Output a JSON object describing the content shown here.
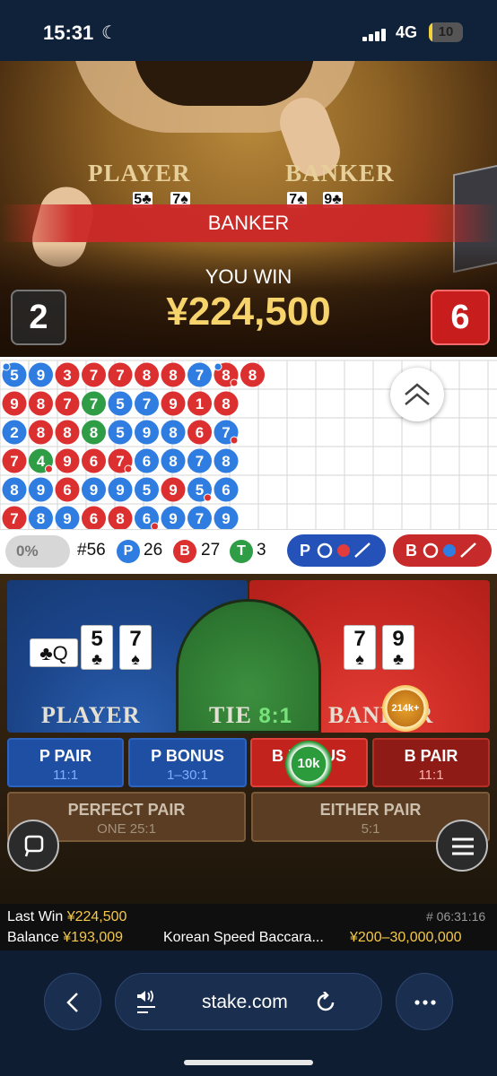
{
  "status_bar": {
    "time": "15:31",
    "network": "4G",
    "battery": "10",
    "battery_level": 0.1
  },
  "stream": {
    "table_player_label": "PLAYER",
    "table_banker_label": "BANKER",
    "player_cards": [
      {
        "rank": "5",
        "suit": "♣"
      },
      {
        "rank": "7",
        "suit": "♠"
      }
    ],
    "banker_cards": [
      {
        "rank": "7",
        "suit": "♠"
      },
      {
        "rank": "9",
        "suit": "♣"
      }
    ],
    "result_banner": "BANKER",
    "win_title": "YOU WIN",
    "win_amount": "¥224,500",
    "player_score": "2",
    "banker_score": "6"
  },
  "roadmap": {
    "colors": {
      "player": "#2f7de1",
      "banker": "#dc2f2f",
      "tie": "#2f9c46"
    },
    "columns": [
      [
        {
          "c": "P",
          "v": "5",
          "pp": true
        },
        {
          "c": "B",
          "v": "9"
        },
        {
          "c": "P",
          "v": "2"
        },
        {
          "c": "B",
          "v": "7"
        },
        {
          "c": "P",
          "v": "8"
        },
        {
          "c": "B",
          "v": "7"
        }
      ],
      [
        {
          "c": "P",
          "v": "9"
        },
        {
          "c": "B",
          "v": "8"
        },
        {
          "c": "B",
          "v": "8"
        },
        {
          "c": "T",
          "v": "4",
          "bp": true
        },
        {
          "c": "P",
          "v": "9"
        },
        {
          "c": "P",
          "v": "8"
        }
      ],
      [
        {
          "c": "B",
          "v": "3"
        },
        {
          "c": "B",
          "v": "7"
        },
        {
          "c": "B",
          "v": "8"
        },
        {
          "c": "B",
          "v": "9"
        },
        {
          "c": "B",
          "v": "6"
        },
        {
          "c": "P",
          "v": "9"
        }
      ],
      [
        {
          "c": "B",
          "v": "7"
        },
        {
          "c": "T",
          "v": "7"
        },
        {
          "c": "T",
          "v": "8"
        },
        {
          "c": "B",
          "v": "6"
        },
        {
          "c": "P",
          "v": "9"
        },
        {
          "c": "B",
          "v": "6"
        }
      ],
      [
        {
          "c": "B",
          "v": "7"
        },
        {
          "c": "P",
          "v": "5"
        },
        {
          "c": "P",
          "v": "5"
        },
        {
          "c": "B",
          "v": "7",
          "bp": true
        },
        {
          "c": "P",
          "v": "9"
        },
        {
          "c": "B",
          "v": "8"
        }
      ],
      [
        {
          "c": "B",
          "v": "8"
        },
        {
          "c": "P",
          "v": "7"
        },
        {
          "c": "P",
          "v": "9"
        },
        {
          "c": "P",
          "v": "6"
        },
        {
          "c": "P",
          "v": "5"
        },
        {
          "c": "P",
          "v": "6",
          "bp": true
        }
      ],
      [
        {
          "c": "B",
          "v": "8"
        },
        {
          "c": "B",
          "v": "9"
        },
        {
          "c": "P",
          "v": "8"
        },
        {
          "c": "P",
          "v": "8"
        },
        {
          "c": "B",
          "v": "9"
        },
        {
          "c": "P",
          "v": "9"
        }
      ],
      [
        {
          "c": "P",
          "v": "7"
        },
        {
          "c": "B",
          "v": "1"
        },
        {
          "c": "B",
          "v": "6"
        },
        {
          "c": "P",
          "v": "7"
        },
        {
          "c": "P",
          "v": "5",
          "bp": true
        },
        {
          "c": "P",
          "v": "7"
        }
      ],
      [
        {
          "c": "B",
          "v": "8",
          "pp": true,
          "bp": true
        },
        {
          "c": "B",
          "v": "8"
        },
        {
          "c": "P",
          "v": "7",
          "bp": true
        },
        {
          "c": "P",
          "v": "8"
        },
        {
          "c": "P",
          "v": "6"
        },
        {
          "c": "P",
          "v": "9"
        }
      ],
      [
        {
          "c": "B",
          "v": "8"
        }
      ]
    ]
  },
  "stats": {
    "percentage": "0%",
    "shoe_number": "#56",
    "player_letter": "P",
    "player_count": "26",
    "banker_letter": "B",
    "banker_count": "27",
    "tie_letter": "T",
    "tie_count": "3",
    "player_predict_letter": "P",
    "banker_predict_letter": "B"
  },
  "betting": {
    "player_label": "PLAYER",
    "tie_label": "TIE",
    "tie_payout": "8:1",
    "banker_label": "BANKER",
    "player_cards": [
      {
        "rank": "5",
        "suit": "♣"
      },
      {
        "rank": "7",
        "suit": "♠"
      }
    ],
    "player_side_card": "♣Q",
    "banker_cards": [
      {
        "rank": "7",
        "suit": "♠"
      },
      {
        "rank": "9",
        "suit": "♣"
      }
    ],
    "banker_chip": "214k+",
    "side_bets": [
      {
        "label": "P PAIR",
        "payout": "11:1"
      },
      {
        "label": "P BONUS",
        "payout": "1–30:1"
      },
      {
        "label": "B BONUS",
        "payout": ""
      },
      {
        "label": "B PAIR",
        "payout": "11:1"
      }
    ],
    "bonus_chip": "10k",
    "perfect_pair": {
      "label": "PERFECT PAIR",
      "payout": "ONE 25:1"
    },
    "either_pair": {
      "label": "EITHER PAIR",
      "payout": "5:1"
    }
  },
  "footer": {
    "last_win_label": "Last Win",
    "last_win_value": "¥224,500",
    "balance_label": "Balance",
    "balance_value": "¥193,009",
    "round_id": "# 06:31:16",
    "table_name": "Korean Speed Baccara...",
    "limits": "¥200–30,000,000"
  },
  "browser": {
    "url": "stake.com"
  }
}
